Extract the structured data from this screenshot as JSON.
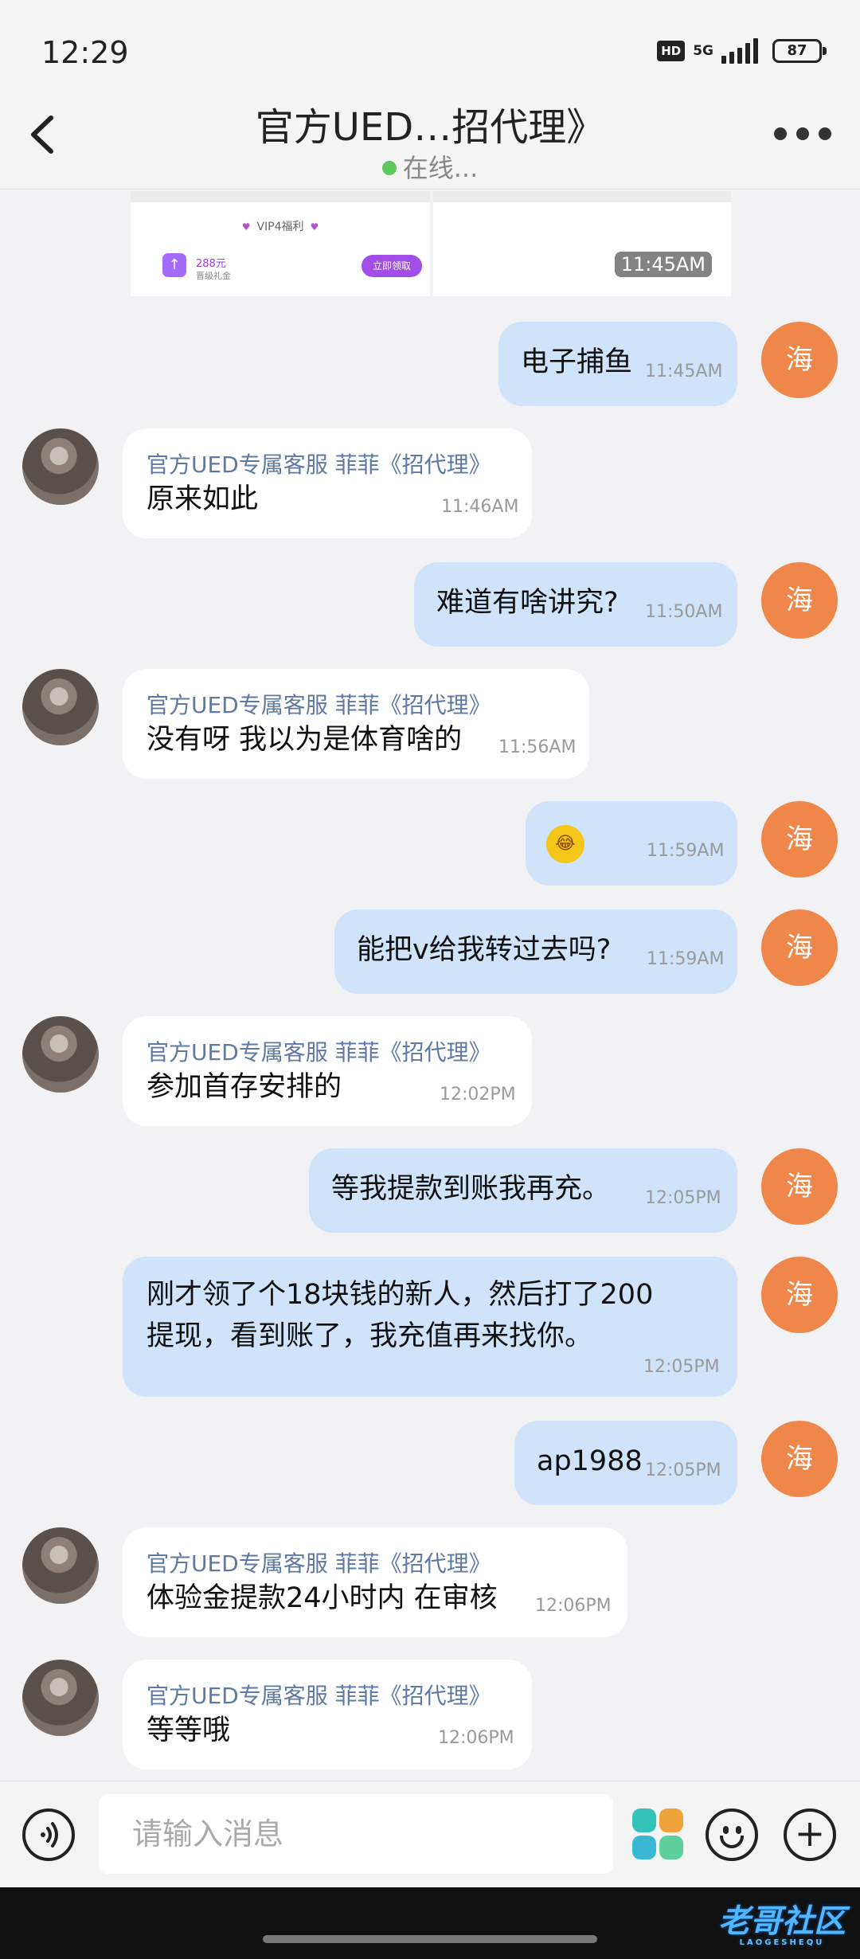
{
  "status": {
    "time": "12:29",
    "hd": "HD",
    "network": "5G",
    "battery": "87"
  },
  "header": {
    "title": "官方UED…招代理》",
    "status": "在线..."
  },
  "card": {
    "vip_label": "VIP4福利",
    "amount": "288元",
    "sub": "晋级礼金",
    "claim": "立即领取",
    "time": "11:45AM"
  },
  "me_avatar": "海",
  "messages": [
    {
      "text": "电子捕鱼",
      "time": "11:45AM"
    },
    {
      "sender": "官方UED专属客服 菲菲《招代理》",
      "text": "原来如此",
      "time": "11:46AM"
    },
    {
      "text": "难道有啥讲究?",
      "time": "11:50AM"
    },
    {
      "sender": "官方UED专属客服 菲菲《招代理》",
      "text": "没有呀 我以为是体育啥的",
      "time": "11:56AM"
    },
    {
      "emoji": "laughing-tears",
      "time": "11:59AM"
    },
    {
      "text": "能把v给我转过去吗?",
      "time": "11:59AM"
    },
    {
      "sender": "官方UED专属客服 菲菲《招代理》",
      "text": "参加首存安排的",
      "time": "12:02PM"
    },
    {
      "text": "等我提款到账我再充。",
      "time": "12:05PM"
    },
    {
      "line1": "刚才领了个18块钱的新人，然后打了200",
      "line2": "提现，看到账了，我充值再来找你。",
      "time": "12:05PM"
    },
    {
      "text": "ap1988",
      "time": "12:05PM"
    },
    {
      "sender": "官方UED专属客服 菲菲《招代理》",
      "text": "体验金提款24小时内 在审核",
      "time": "12:06PM"
    },
    {
      "sender": "官方UED专属客服 菲菲《招代理》",
      "text": "等等哦",
      "time": "12:06PM"
    }
  ],
  "input": {
    "placeholder": "请输入消息"
  },
  "watermark": {
    "main": "老哥社区",
    "sub": "LAOGESHEQU"
  }
}
